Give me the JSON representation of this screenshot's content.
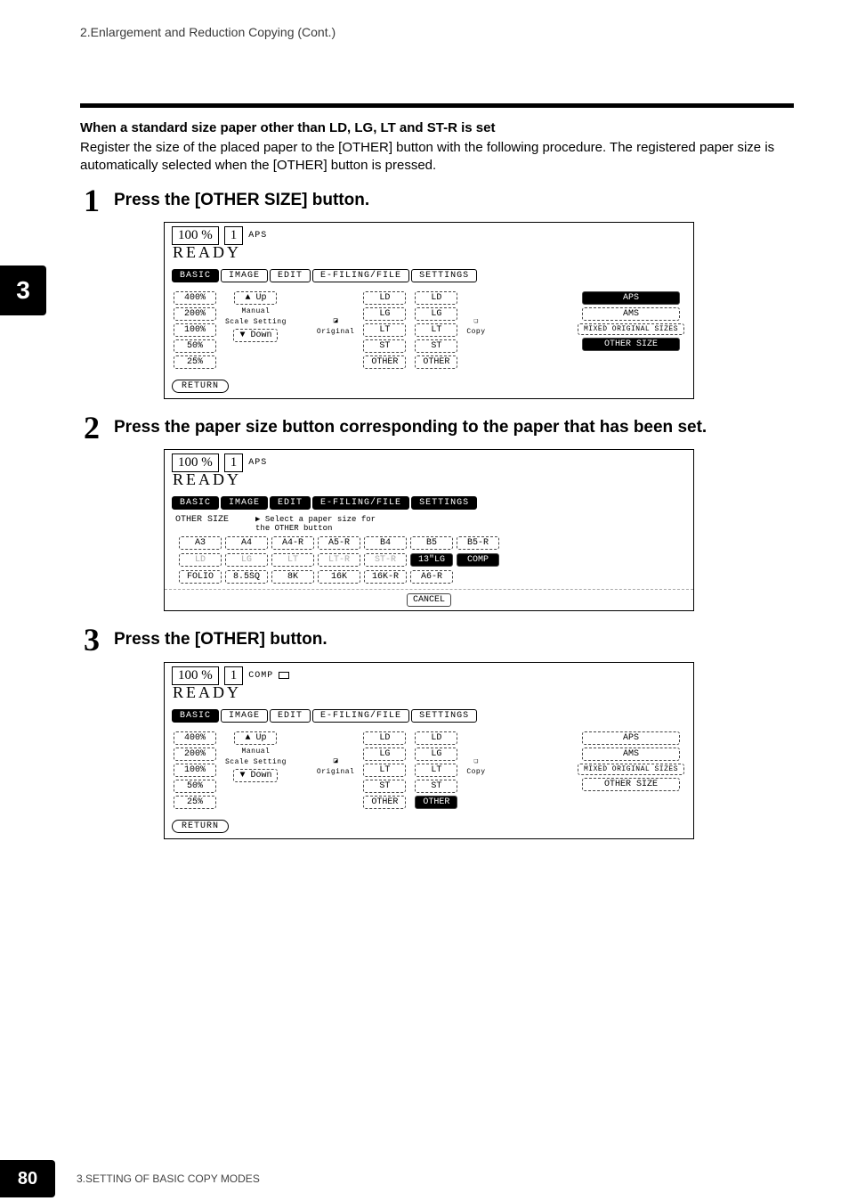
{
  "breadcrumb": "2.Enlargement and Reduction Copying (Cont.)",
  "sidebar_chapter": "3",
  "heading": "When a standard size paper other than LD, LG, LT and ST-R is set",
  "body": "Register the size of the placed paper to the [OTHER] button with the following procedure. The registered paper size is automatically selected when the [OTHER] button is pressed.",
  "steps": [
    {
      "num": "1",
      "title": "Press the [OTHER SIZE] button."
    },
    {
      "num": "2",
      "title": "Press the paper size button corresponding to the paper that has been set."
    },
    {
      "num": "3",
      "title": "Press the [OTHER] button."
    }
  ],
  "screen1": {
    "zoom": "100 %",
    "qty": "1",
    "mode": "APS",
    "status": "READY",
    "tabs": [
      "BASIC",
      "IMAGE",
      "EDIT",
      "E-FILING/FILE",
      "SETTINGS"
    ],
    "active_tab": "BASIC",
    "ratios": [
      "400%",
      "200%",
      "100%",
      "50%",
      "25%"
    ],
    "up": "▲  Up",
    "down": "▼  Down",
    "scale_label1": "Manual",
    "scale_label2": "Scale Setting",
    "orig_label": "Original",
    "copy_label": "Copy",
    "paper": [
      "LD",
      "LG",
      "LT",
      "ST",
      "OTHER"
    ],
    "right_btns": [
      "APS",
      "AMS",
      "MIXED ORIGINAL SIZES",
      "OTHER SIZE"
    ],
    "right_dark": [
      true,
      false,
      false,
      true
    ],
    "return": "RETURN"
  },
  "screen2": {
    "zoom": "100 %",
    "qty": "1",
    "mode": "APS",
    "status": "READY",
    "tabs": [
      "BASIC",
      "IMAGE",
      "EDIT",
      "E-FILING/FILE",
      "SETTINGS"
    ],
    "other_title": "OTHER SIZE",
    "prompt": "▶ Select a paper size for\n  the OTHER button",
    "row1": [
      "A3",
      "A4",
      "A4-R",
      "A5-R",
      "B4",
      "B5",
      "B5-R"
    ],
    "row2": [
      "LD",
      "LG",
      "LT",
      "LT-R",
      "ST-R",
      "13\"LG",
      "COMP"
    ],
    "row2_dark": [
      false,
      false,
      false,
      false,
      false,
      true,
      true
    ],
    "row3": [
      "FOLIO",
      "8.5SQ",
      "8K",
      "16K",
      "16K-R",
      "A6-R"
    ],
    "cancel": "CANCEL"
  },
  "screen3": {
    "zoom": "100 %",
    "qty": "1",
    "mode": "COMP",
    "status": "READY",
    "tabs": [
      "BASIC",
      "IMAGE",
      "EDIT",
      "E-FILING/FILE",
      "SETTINGS"
    ],
    "active_tab": "BASIC",
    "ratios": [
      "400%",
      "200%",
      "100%",
      "50%",
      "25%"
    ],
    "up": "▲  Up",
    "down": "▼  Down",
    "scale_label1": "Manual",
    "scale_label2": "Scale Setting",
    "orig_label": "Original",
    "copy_label": "Copy",
    "paper": [
      "LD",
      "LG",
      "LT",
      "ST",
      "OTHER"
    ],
    "right_btns": [
      "APS",
      "AMS",
      "MIXED ORIGINAL SIZES",
      "OTHER SIZE"
    ],
    "right_dark": [
      false,
      false,
      false,
      false
    ],
    "return": "RETURN"
  },
  "footer": {
    "page": "80",
    "text": "3.SETTING OF BASIC COPY MODES"
  }
}
